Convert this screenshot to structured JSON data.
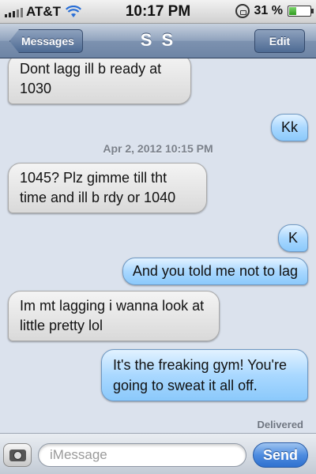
{
  "status_bar": {
    "carrier": "AT&T",
    "time": "10:17 PM",
    "battery": "31 %",
    "battery_level": 0.31
  },
  "nav": {
    "back_label": "Messages",
    "title": "S S",
    "edit_label": "Edit"
  },
  "conversation": {
    "messages": [
      {
        "direction": "incoming",
        "text": "Dont lagg ill b ready at 1030"
      },
      {
        "direction": "outgoing",
        "text": "Kk"
      },
      {
        "direction": "incoming",
        "text": "1045? Plz gimme till tht time and ill b rdy or 1040"
      },
      {
        "direction": "outgoing",
        "text": "K"
      },
      {
        "direction": "outgoing",
        "text": "And you told me not to lag"
      },
      {
        "direction": "incoming",
        "text": "Im mt lagging i wanna look at little pretty lol"
      },
      {
        "direction": "outgoing",
        "text": "It's the freaking gym! You're going to sweat it all off."
      }
    ],
    "timestamp": "Apr 2, 2012 10:15 PM",
    "delivered": "Delivered"
  },
  "input_bar": {
    "placeholder": "iMessage",
    "value": "",
    "send_label": "Send"
  }
}
